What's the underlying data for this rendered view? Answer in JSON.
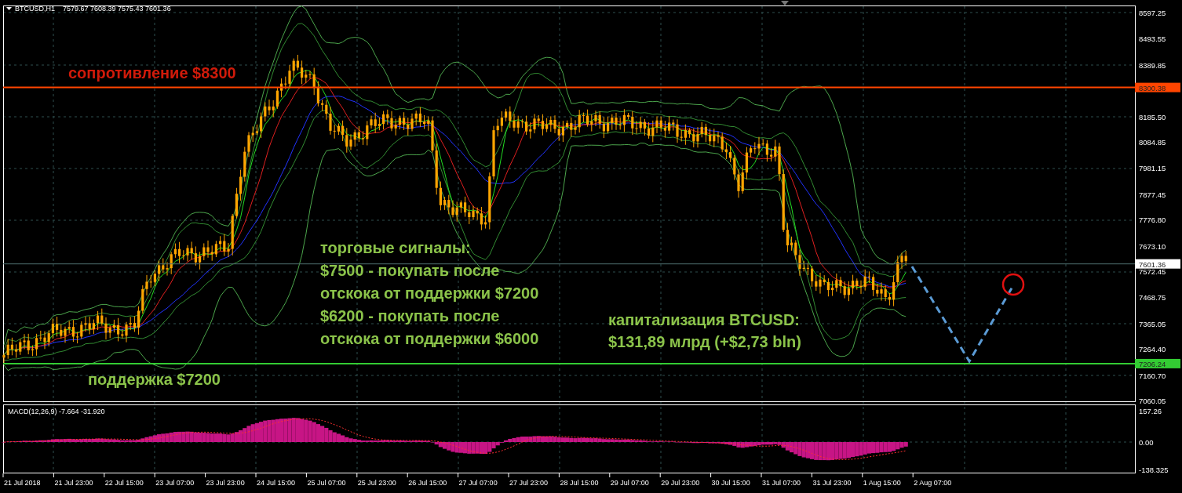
{
  "header": {
    "symbol": "BTCUSD,H1",
    "ohlc": "7579.67 7608.39 7575.43 7601.36"
  },
  "price_axis": {
    "labels": [
      "8597.25",
      "8493.55",
      "8389.85",
      "8185.50",
      "8084.85",
      "7981.15",
      "7877.45",
      "7776.80",
      "7673.10",
      "7572.45",
      "7468.75",
      "7365.05",
      "7264.40",
      "7160.70",
      "7060.05"
    ]
  },
  "price_tags": [
    {
      "kind": "level",
      "label": "8300.38",
      "color": "#ff4500"
    },
    {
      "kind": "price",
      "label": "7601.36",
      "color": "#ffffff"
    },
    {
      "kind": "level",
      "label": "7206.24",
      "color": "#33cc33"
    }
  ],
  "annotations": {
    "resistance": "сопротивление $8300",
    "support": "поддержка $7200",
    "signals": {
      "title": "торговые сигналы:",
      "items": [
        {
          "lines": [
            "$7500 - покупать после",
            "отскока от поддержки $7200"
          ]
        },
        {
          "lines": [
            "$6200 - покупать после",
            "отскока от поддержки $6000"
          ]
        }
      ]
    },
    "capitalization": {
      "lines": [
        "капитализация BTCUSD:",
        "$131,89 млрд (+$2,73 bln)"
      ]
    }
  },
  "macd": {
    "label": "MACD(12,26,9) -7.664 -31.920",
    "axis_labels": [
      "157.26",
      "0.00",
      "-138.325"
    ]
  },
  "time_axis": {
    "labels": [
      "21 Jul 2018",
      "21 Jul 23:00",
      "22 Jul 15:00",
      "23 Jul 07:00",
      "23 Jul 23:00",
      "24 Jul 15:00",
      "25 Jul 07:00",
      "25 Jul 23:00",
      "26 Jul 15:00",
      "27 Jul 07:00",
      "27 Jul 23:00",
      "28 Jul 15:00",
      "29 Jul 07:00",
      "29 Jul 23:00",
      "30 Jul 15:00",
      "31 Jul 07:00",
      "31 Jul 23:00",
      "1 Aug 15:00",
      "2 Aug 07:00"
    ]
  }
}
